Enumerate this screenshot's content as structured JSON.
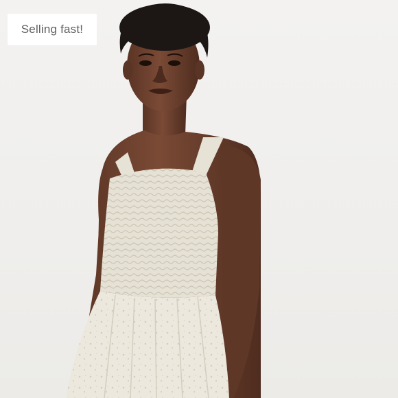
{
  "listing": {
    "badge_label": "Selling fast!",
    "photo_icon": "product-photo"
  },
  "colors": {
    "background": "#f1f0ee",
    "badge_background": "#ffffff",
    "badge_text": "#5f5f5f",
    "skin": "#6e4330",
    "hair": "#1c1715",
    "dress": "#e9e5da"
  }
}
